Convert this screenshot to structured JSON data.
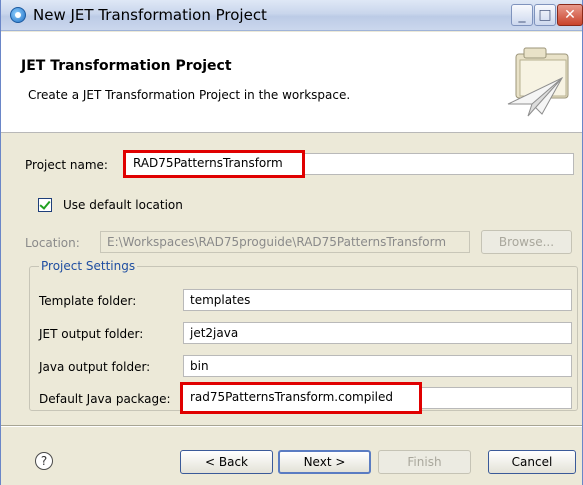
{
  "window": {
    "title": "New JET Transformation Project"
  },
  "banner": {
    "title": "JET Transformation Project",
    "description": "Create a JET Transformation Project in the workspace."
  },
  "project_name": {
    "label": "Project name:",
    "value": "RAD75PatternsTransform"
  },
  "default_location": {
    "label": "Use default location",
    "checked": true
  },
  "location": {
    "label": "Location:",
    "value": "E:\\Workspaces\\RAD75proguide\\RAD75PatternsTransform",
    "browse_label": "Browse..."
  },
  "settings": {
    "title": "Project Settings",
    "template_folder": {
      "label": "Template folder:",
      "value": "templates"
    },
    "jet_output_folder": {
      "label": "JET output folder:",
      "value": "jet2java"
    },
    "java_output_folder": {
      "label": "Java output folder:",
      "value": "bin"
    },
    "default_java_package": {
      "label": "Default Java package:",
      "value": "rad75PatternsTransform.compiled"
    }
  },
  "buttons": {
    "help": "?",
    "back": "< Back",
    "next": "Next >",
    "finish": "Finish",
    "cancel": "Cancel"
  },
  "colors": {
    "highlight": "#e00000",
    "group_title": "#1f4ea1"
  }
}
